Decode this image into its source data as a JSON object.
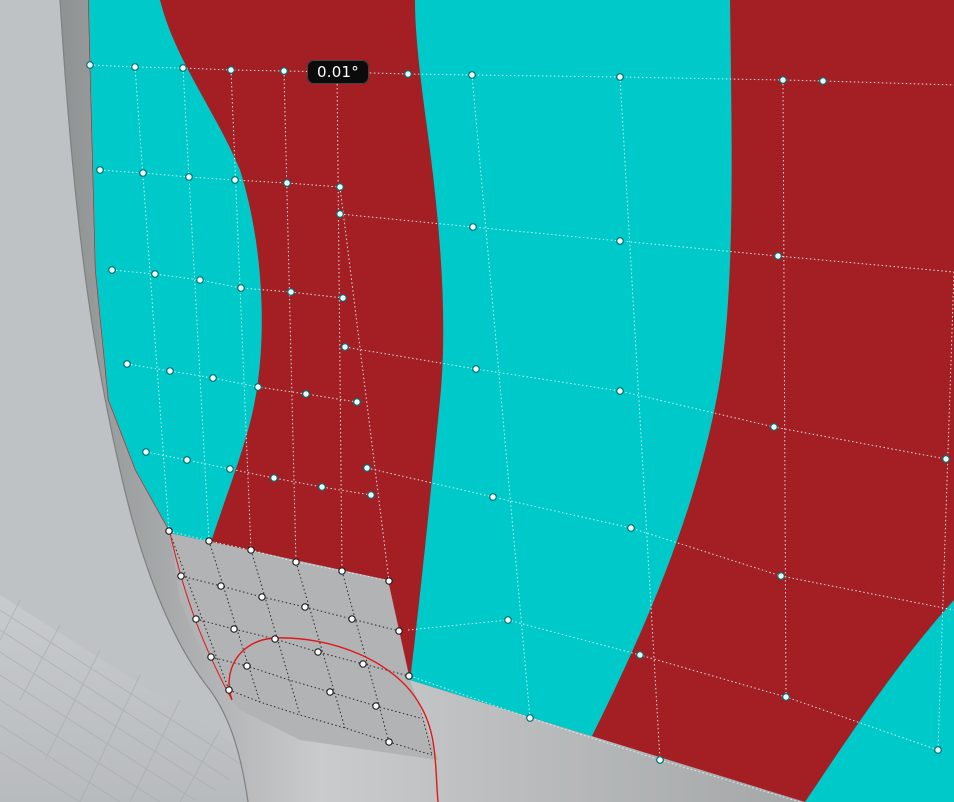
{
  "viewport": {
    "angle_readout": "0.01°",
    "stripe_colors": {
      "red": "#a31f24",
      "cyan": "#00c9c9",
      "surface_gray": "#a9a9a9",
      "grid_floor": "#c3c6c8"
    },
    "control_point_color": "#e8ffff",
    "edge_curve_color": "#e01818"
  }
}
